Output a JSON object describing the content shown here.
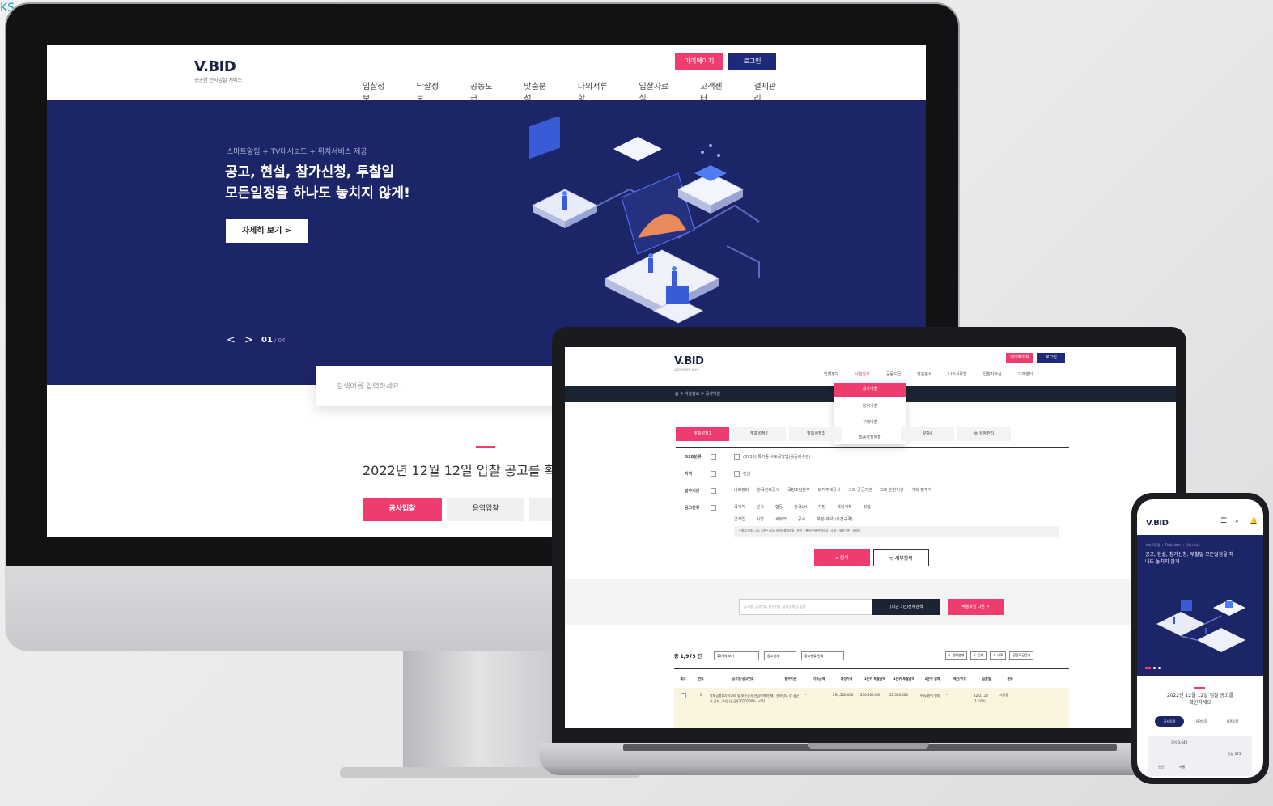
{
  "corner_tag": "KS",
  "desktop": {
    "logo": "V.BID",
    "logo_sub": "공공한 전자입찰 서비스",
    "mypage_btn": "마이페이지",
    "login_btn": "로그인",
    "nav": [
      "입찰정보",
      "낙찰정보",
      "공동도급",
      "맞춤분석",
      "나의서류함",
      "입찰자료실",
      "고객센터",
      "결제관리"
    ],
    "hero_small": "스마트알림 + TV대시보드 + 위치서비스 제공",
    "hero_title_1": "공고, 현설, 참가신청, 투찰일",
    "hero_title_2": "모든일정을 하나도 놓치지 않게!",
    "hero_btn": "자세히 보기 >",
    "slider_prev": "<",
    "slider_next": ">",
    "slider_current": "01",
    "slider_total": "/ 04",
    "search_placeholder": "검색어를 입력하세요.",
    "notice_title": "2022년 12월 12일 입찰 공고를 확",
    "tab_construction": "공사입찰",
    "tab_service": "용역입찰"
  },
  "laptop": {
    "logo": "V.BID",
    "logo_sub": "공공한 전자입찰 서비스",
    "top_btn_1": "마이페이지",
    "top_btn_2": "로그인",
    "nav": [
      "입찰정보",
      "낙찰정보",
      "공동도급",
      "맞춤분석",
      "나의서류함",
      "입찰자료실",
      "고객센터"
    ],
    "breadcrumb": "홈 > 낙찰정보 > 공사낙찰",
    "dropdown": [
      "공사낙찰",
      "용역낙찰",
      "구매낙찰",
      "최종낙찰현황"
    ],
    "search_tabs": [
      "맞춤설정1",
      "맞춤설정2",
      "맞춤설정3",
      "맞춤4",
      "설정관리"
    ],
    "filter_labels": [
      "G2B분류",
      "지역",
      "발주기관",
      "공고분류"
    ],
    "filter_g2b": "(6736) 특기증 수도공방법(공중배수관)",
    "filter_region": "전남",
    "filter_org": [
      "나라장터",
      "한국전력공사",
      "국방조달본부",
      "토지주택공사",
      "그외 공공기관",
      "그외 민간기관",
      "기타 발주처"
    ],
    "filter_cat_row1": [
      "국가지",
      "인가",
      "협동",
      "한국LH",
      "지방",
      "재정계획",
      "직접"
    ],
    "filter_cat_row2": [
      "군가입",
      "시방",
      "세부러",
      "공시",
      "예정(계약)(사전규격)"
    ],
    "filter_note": "* 예가/기초 : 0% 기준   * G2B 참가등록마감일 : 표기   * 용역/구매 변경공고 : 수정   * 발표기준 : 입력일",
    "search_btn": "검색",
    "detail_btn": "세부항목",
    "keyword_placeholder": "공고명, 공고번호, 발주기관, 참여업체 등 입력",
    "keyword_btn": "(최근 3년)전체검색",
    "excel_btn": "엑셀파일 다운 >",
    "total_label": "총 1,975 건",
    "list_controls": [
      "10개씩 보기",
      "공고일자",
      "공고분류 전체"
    ],
    "list_right": [
      "> 참여업체",
      "> 인쇄",
      "> 새로",
      "공동도급관리"
    ],
    "columns": [
      "체크",
      "번호",
      "공고명/공고번호",
      "발주기관",
      "기초금액",
      "예정가격",
      "1순위 투찰금액",
      "1순위 투찰금액",
      "1순위 업체",
      "예산/기초",
      "입찰일",
      "분류"
    ],
    "row": {
      "num": "1",
      "title": "목포공항(고)학교로 및 보수공사 전공하여(인제)주 장하, 구입 (곤급)[20201004-1-00]",
      "org": "전라남도 양 광군",
      "base": "-",
      "estimate": "292,500,000",
      "bid1": "236,500,000",
      "bid2": "50,500,000",
      "company": "(주)도원이 엔지",
      "ratio": "-",
      "date": "22.01.18 (13:00)",
      "cat": "시공중"
    }
  },
  "phone": {
    "logo": "V.BID",
    "hero_small": "스마트알림 + TV대시보드 + 위치서비스",
    "hero_title": "공고, 현설, 참가신청, 투찰일 모든일정을 하나도 놓치지 않게",
    "notice_title": "2022년 12월 12일 입찰 공고를 확인하세요",
    "tabs": [
      "공사입찰",
      "용역입찰",
      "물품입찰"
    ],
    "map_labels": [
      "경기 3,648",
      "전남 375",
      "인천",
      "서울"
    ]
  },
  "colors": {
    "navy": "#1d2569",
    "pink": "#ee3c6f",
    "button_navy": "#1d2a7a"
  }
}
